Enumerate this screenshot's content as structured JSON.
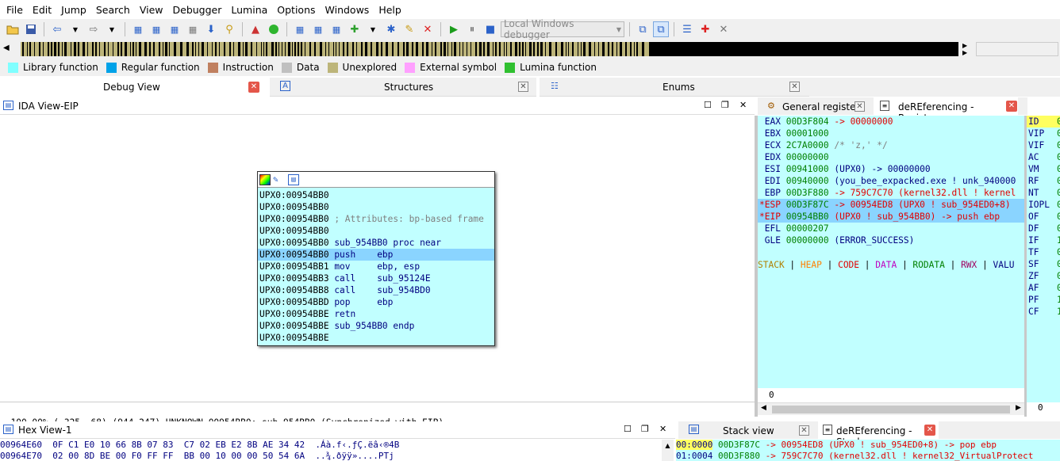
{
  "menu": [
    "File",
    "Edit",
    "Jump",
    "Search",
    "View",
    "Debugger",
    "Lumina",
    "Options",
    "Windows",
    "Help"
  ],
  "toolbar": {
    "debugger_select": "Local Windows debugger"
  },
  "legend": [
    {
      "label": "Library function",
      "color": "#80ffff"
    },
    {
      "label": "Regular function",
      "color": "#00a2e8"
    },
    {
      "label": "Instruction",
      "color": "#c08060"
    },
    {
      "label": "Data",
      "color": "#c0c0c0"
    },
    {
      "label": "Unexplored",
      "color": "#bdb57a"
    },
    {
      "label": "External symbol",
      "color": "#ffa0ff"
    },
    {
      "label": "Lumina function",
      "color": "#30c030"
    }
  ],
  "top_tabs": [
    "Debug View",
    "Structures",
    "Enums"
  ],
  "ida_view": {
    "title": "IDA View-EIP",
    "popup_lines": [
      {
        "addr": "UPX0:00954BB0",
        "text": "",
        "kind": "plain"
      },
      {
        "addr": "UPX0:00954BB0",
        "text": "",
        "kind": "plain"
      },
      {
        "addr": "UPX0:00954BB0",
        "text": "; Attributes: bp-based frame",
        "kind": "comment"
      },
      {
        "addr": "UPX0:00954BB0",
        "text": "",
        "kind": "plain"
      },
      {
        "addr": "UPX0:00954BB0",
        "text": "sub_954BB0 proc near",
        "kind": "code"
      },
      {
        "addr": "UPX0:00954BB0",
        "text": "push    ebp",
        "kind": "code",
        "selected": true
      },
      {
        "addr": "UPX0:00954BB1",
        "text": "mov     ebp, esp",
        "kind": "code"
      },
      {
        "addr": "UPX0:00954BB3",
        "text": "call    sub_95124E",
        "kind": "code"
      },
      {
        "addr": "UPX0:00954BB8",
        "text": "call    sub_954BD0",
        "kind": "code"
      },
      {
        "addr": "UPX0:00954BBD",
        "text": "pop     ebp",
        "kind": "code"
      },
      {
        "addr": "UPX0:00954BBE",
        "text": "retn",
        "kind": "code"
      },
      {
        "addr": "UPX0:00954BBE",
        "text": "sub_954BB0 endp",
        "kind": "code"
      },
      {
        "addr": "UPX0:00954BBE",
        "text": "",
        "kind": "plain"
      }
    ],
    "status": "100.00% (-325,-68) (944,247) UNKNOWN 00954BB0: sub_954BB0 (Synchronized with EIP)"
  },
  "registers": {
    "tabs": [
      "General registers",
      "deREferencing - Registers"
    ],
    "rows": [
      {
        "prefix": " ",
        "name": "EAX",
        "value": "00D3F804",
        "rest": "-> 00000000",
        "hl": false
      },
      {
        "prefix": " ",
        "name": "EBX",
        "value": "00001000",
        "rest": "",
        "hl": false
      },
      {
        "prefix": " ",
        "name": "ECX",
        "value": "2C7A0000",
        "rest": "/* 'z,' */",
        "hl": false
      },
      {
        "prefix": " ",
        "name": "EDX",
        "value": "00000000",
        "rest": "",
        "hl": false
      },
      {
        "prefix": " ",
        "name": "ESI",
        "value": "00941000",
        "rest": "(UPX0) -> 00000000",
        "hl": false
      },
      {
        "prefix": " ",
        "name": "EDI",
        "value": "00940000",
        "rest": "(you_bee_expacked.exe ! unk_940000",
        "hl": false
      },
      {
        "prefix": " ",
        "name": "EBP",
        "value": "00D3F880",
        "rest": "-> 759C7C70 (kernel32.dll ! kernel",
        "hl": false
      },
      {
        "prefix": "*",
        "name": "ESP",
        "value": "00D3F87C",
        "rest": "-> 00954ED8 (UPX0 ! sub_954ED0+8)",
        "hl": true
      },
      {
        "prefix": "*",
        "name": "EIP",
        "value": "00954BB0",
        "rest": "(UPX0 ! sub_954BB0) -> push ebp",
        "hl": true
      },
      {
        "prefix": " ",
        "name": "EFL",
        "value": "00000207",
        "rest": "",
        "hl": false
      },
      {
        "prefix": " ",
        "name": "GLE",
        "value": "00000000",
        "rest": "(ERROR_SUCCESS)",
        "hl": false
      }
    ],
    "mem_legend": [
      "STACK",
      "HEAP",
      "CODE",
      "DATA",
      "RODATA",
      "RWX",
      "VALU"
    ],
    "mem_colors": [
      "#b08000",
      "#ff8000",
      "#e00000",
      "#c000c0",
      "#008000",
      "#a00060",
      "#000080"
    ],
    "footer": "0"
  },
  "flags": {
    "names": [
      "ID",
      "VIP",
      "VIF",
      "AC",
      "VM",
      "RF",
      "NT",
      "IOPL",
      "OF",
      "DF",
      "IF",
      "TF",
      "SF",
      "ZF",
      "AF",
      "PF",
      "CF"
    ],
    "values": [
      "0",
      "0",
      "0",
      "0",
      "0",
      "0",
      "0",
      "0",
      "0",
      "0",
      "1",
      "0",
      "0",
      "0",
      "0",
      "1",
      "1"
    ],
    "footer": "0"
  },
  "hex_view": {
    "title": "Hex View-1",
    "rows": [
      "00964E60  0F C1 E0 10 66 8B 07 83  C7 02 EB E2 8B AE 34 42  .Áà.f‹.ƒÇ.ëâ‹®4B",
      "00964E70  02 00 8D BE 00 F0 FF FF  BB 00 10 00 00 50 54 6A  ..¾.ðÿÿ»....PTj"
    ]
  },
  "stack": {
    "tabs": [
      "Stack view",
      "deREferencing - Stack"
    ],
    "rows": [
      {
        "off": "00:0000",
        "addr": "00D3F87C",
        "rest": "-> 00954ED8 (UPX0 ! sub_954ED0+8) -> pop ebp"
      },
      {
        "off": "01:0004",
        "addr": "00D3F880",
        "rest": "-> 759C7C70 (kernel32.dll ! kernel32_VirtualProtect"
      }
    ]
  }
}
